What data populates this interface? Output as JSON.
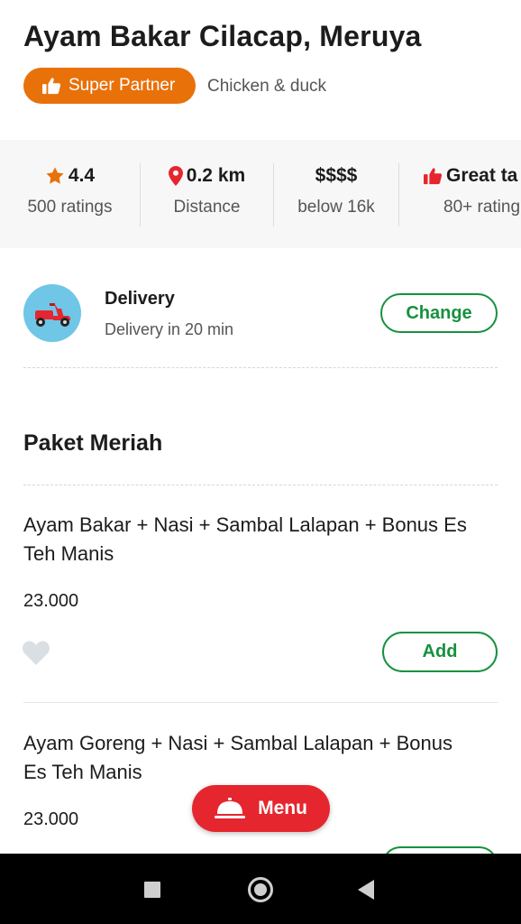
{
  "restaurant": {
    "name": "Ayam Bakar Cilacap, Meruya",
    "badge": "Super Partner",
    "category": "Chicken & duck"
  },
  "stats": [
    {
      "icon": "star-icon",
      "value": "4.4",
      "label": "500 ratings"
    },
    {
      "icon": "location-pin-icon",
      "value": "0.2 km",
      "label": "Distance"
    },
    {
      "icon": "",
      "value": "$$$$",
      "label": "below 16k"
    },
    {
      "icon": "thumbs-up-icon",
      "value": "Great ta",
      "label": "80+ rating"
    }
  ],
  "delivery": {
    "title": "Delivery",
    "subtitle": "Delivery in 20 min",
    "change_label": "Change"
  },
  "section": {
    "title": "Paket Meriah"
  },
  "items": [
    {
      "name": "Ayam Bakar + Nasi + Sambal Lalapan  + Bonus Es Teh Manis",
      "price": "23.000",
      "add_label": "Add"
    },
    {
      "name": "Ayam Goreng + Nasi + Sambal Lalapan + Bonus Es Teh Manis",
      "price": "23.000"
    }
  ],
  "menu_button": {
    "label": "Menu"
  },
  "colors": {
    "badge": "#e8710a",
    "accent_green": "#16913d",
    "menu_red": "#e5262f",
    "scooter_bg": "#6fc6e6"
  }
}
